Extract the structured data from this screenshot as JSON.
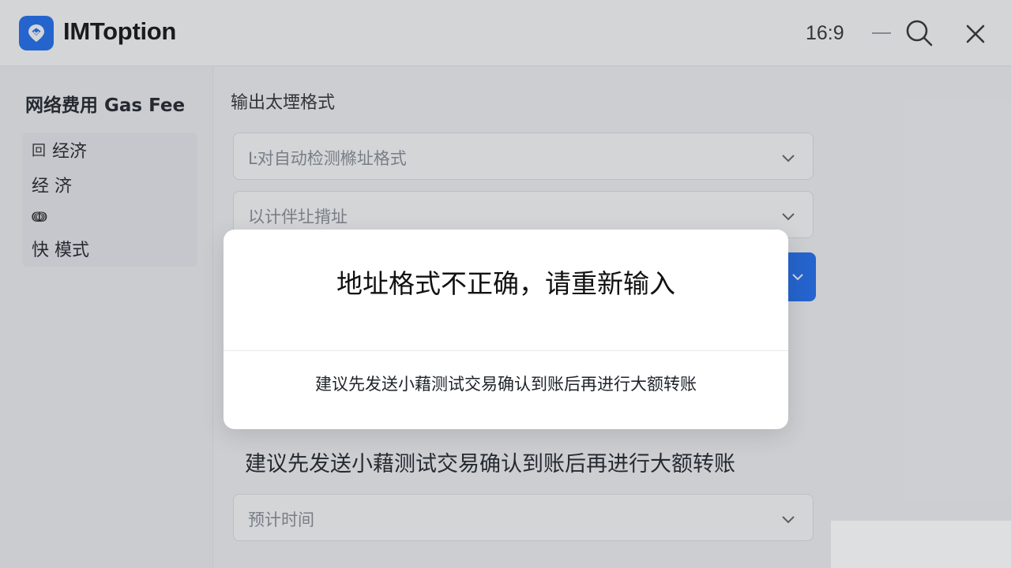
{
  "app": {
    "title": "IMToption",
    "aspect_ratio": "16:9"
  },
  "icons": {
    "logo": "location-pin-icon",
    "minimize": "minimize-icon",
    "search": "search-icon",
    "close": "close-icon",
    "chevron": "chevron-down-icon"
  },
  "colors": {
    "accent": "#1f6ff2"
  },
  "sidebar": {
    "title": "网络费用 Gas Fee",
    "items": [
      {
        "icon": "回",
        "label": "经济"
      },
      {
        "icon": "",
        "label": "经 济"
      },
      {
        "icon": "ↈ",
        "label": ""
      },
      {
        "icon": "",
        "label": "快 模式"
      }
    ]
  },
  "main": {
    "section_label": "输出太堙格式",
    "selects": [
      {
        "value": "Ŀ对自动检测樤址格式"
      },
      {
        "value": "以计伴圵揹址"
      },
      {
        "value": "预计时间"
      }
    ],
    "tip": "建议先发送小藉测试交易确认到账后再进行大额转账"
  },
  "dialog": {
    "title": "地址格式不正确，请重新输入",
    "message": "建议先发送小藉测试交易确认到账后再进行大额转账"
  }
}
